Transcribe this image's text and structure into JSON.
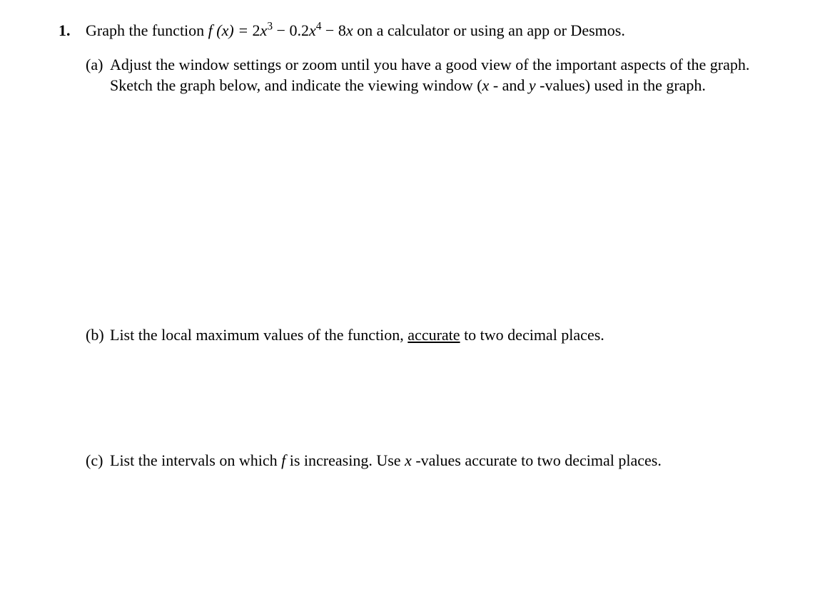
{
  "problem": {
    "number": "1.",
    "stem_before": "Graph the function ",
    "func_lhs": "f (x) = ",
    "term1_coeff": "2",
    "term1_var": "x",
    "term1_exp": "3",
    "minus1": " − ",
    "term2_coeff": "0.2",
    "term2_var": "x",
    "term2_exp": "4",
    "minus2": " − ",
    "term3_coeff": "8",
    "term3_var": "x",
    "stem_after": " on a calculator or using an app or Desmos.",
    "parts": {
      "a": {
        "label": "(a)",
        "line1": "Adjust the window settings or zoom until you have a good view of the important aspects of the graph.",
        "line2_before": "Sketch the graph below, and indicate the viewing window (",
        "line2_x": "x",
        "line2_mid": " - and ",
        "line2_y": "y",
        "line2_after": " -values) used in the graph."
      },
      "b": {
        "label": "(b)",
        "text_before": "List the local maximum values of the function, ",
        "text_underlined": "accurate",
        "text_after": " to two decimal places."
      },
      "c": {
        "label": "(c)",
        "text_before": "List the intervals on which ",
        "f_var": "f",
        "text_mid": " is increasing. Use ",
        "x_var": "x",
        "text_after": " -values accurate to two decimal places."
      }
    }
  }
}
